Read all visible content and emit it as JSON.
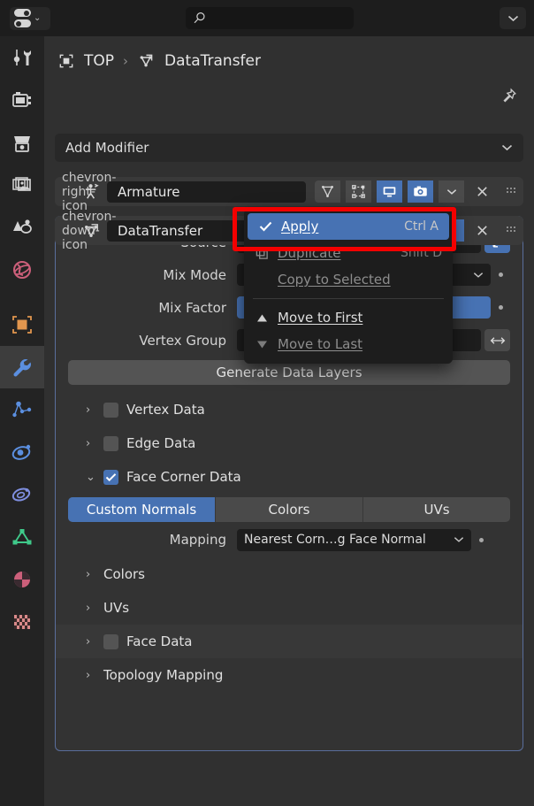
{
  "topbar": {
    "editor_type_icon": "editor-type-toggles-icon",
    "editor_type_chevron": "⌄",
    "search_icon": "search-icon",
    "search_value": "",
    "search_placeholder": "",
    "right_chevron": "⌄"
  },
  "sidebar": {
    "items": [
      {
        "name": "tool",
        "icon": "tool-screwdriver-wrench-icon",
        "color": "#d3d3d3",
        "active": false
      },
      {
        "name": "render",
        "icon": "render-camera-back-icon",
        "color": "#d3d3d3",
        "active": false
      },
      {
        "name": "output",
        "icon": "output-printer-icon",
        "color": "#d3d3d3",
        "active": false
      },
      {
        "name": "view-layer",
        "icon": "view-layer-images-icon",
        "color": "#d3d3d3",
        "active": false
      },
      {
        "name": "scene",
        "icon": "scene-cone-sphere-icon",
        "color": "#d3d3d3",
        "active": false
      },
      {
        "name": "world",
        "icon": "world-globe-icon",
        "color": "#cc5f7a",
        "active": false
      },
      {
        "name": "object",
        "icon": "object-square-brackets-icon",
        "color": "#e2964e",
        "active": false
      },
      {
        "name": "modifiers",
        "icon": "wrench-icon",
        "color": "#5b8fe0",
        "active": true
      },
      {
        "name": "particles",
        "icon": "particles-icon",
        "color": "#5b8fe0",
        "active": false
      },
      {
        "name": "physics",
        "icon": "physics-orbit-icon",
        "color": "#5b8fe0",
        "active": false
      },
      {
        "name": "constraints",
        "icon": "constraints-clamp-icon",
        "color": "#7f8fe0",
        "active": false
      },
      {
        "name": "object-data",
        "icon": "object-data-triangle-icon",
        "color": "#3fc98a",
        "active": false
      },
      {
        "name": "material",
        "icon": "material-sphere-icon",
        "color": "#cc5f7a",
        "active": false
      },
      {
        "name": "texture",
        "icon": "texture-checker-icon",
        "color": "#d98a8a",
        "active": false
      }
    ]
  },
  "breadcrumb": {
    "object_icon": "object-brackets-icon",
    "object_label": "TOP",
    "separator": "›",
    "modifier_icon": "datatransfer-modifier-icon",
    "modifier_label": "DataTransfer",
    "pin_icon": "pin-icon"
  },
  "add_modifier": {
    "label": "Add Modifier",
    "chevron": "⌄"
  },
  "modifiers": [
    {
      "expand_icon": "chevron-right-icon",
      "expanded": false,
      "type_icon": "armature-modifier-icon",
      "name": "Armature",
      "toggles": [
        {
          "name": "edit-mode-toggle",
          "icon": "triangle-mesh-icon",
          "on": false
        },
        {
          "name": "on-cage-toggle",
          "icon": "cage-vertices-icon",
          "on": false
        },
        {
          "name": "realtime-toggle",
          "icon": "display-monitor-icon",
          "on": true
        },
        {
          "name": "render-toggle",
          "icon": "camera-icon",
          "on": true
        }
      ],
      "dropdown_icon": "chevron-down-icon",
      "close_icon": "close-x-icon",
      "drag_icon": "drag-handle-dots-icon"
    },
    {
      "expand_icon": "chevron-down-icon",
      "expanded": true,
      "type_icon": "datatransfer-modifier-icon",
      "name": "DataTransfer",
      "toggles": [
        {
          "name": "edit-mode-toggle",
          "icon": "triangle-mesh-icon",
          "on": false
        },
        {
          "name": "on-cage-toggle",
          "icon": "cage-vertices-icon",
          "on": false
        },
        {
          "name": "realtime-toggle",
          "icon": "display-monitor-icon",
          "on": true
        },
        {
          "name": "render-toggle",
          "icon": "camera-icon",
          "on": true
        }
      ],
      "dropdown_icon": "chevron-down-icon",
      "close_icon": "close-x-icon",
      "drag_icon": "drag-handle-dots-icon"
    }
  ],
  "properties": {
    "source": {
      "label": "Source",
      "value": "",
      "object_transform_icon": "object-transform-icon",
      "object_transform_on": true
    },
    "mix_mode": {
      "label": "Mix Mode",
      "value": "",
      "chevron": "⌄",
      "animate_dot": "animate-dot"
    },
    "mix_factor": {
      "label": "Mix Factor",
      "value": "",
      "animate_dot": "animate-dot"
    },
    "vertex_group": {
      "label": "Vertex Group",
      "value": "",
      "invert_icon": "invert-arrows-icon"
    },
    "generate_button": {
      "label": "Generate Data Layers"
    },
    "sections": [
      {
        "name": "vertex-data",
        "label": "Vertex Data",
        "arrow": "›",
        "checkbox": true,
        "checked": false,
        "expanded": false
      },
      {
        "name": "edge-data",
        "label": "Edge Data",
        "arrow": "›",
        "checkbox": true,
        "checked": false,
        "expanded": false
      },
      {
        "name": "face-corner-data",
        "label": "Face Corner Data",
        "arrow": "⌄",
        "checkbox": true,
        "checked": true,
        "expanded": true
      }
    ],
    "face_corner_tabs": [
      {
        "name": "custom-normals",
        "label": "Custom Normals",
        "active": true
      },
      {
        "name": "colors",
        "label": "Colors",
        "active": false
      },
      {
        "name": "uvs",
        "label": "UVs",
        "active": false
      }
    ],
    "mapping": {
      "label": "Mapping",
      "value": "Nearest Corn…g Face Normal",
      "chevron": "⌄",
      "animate_dot": "animate-dot"
    },
    "bottom_sections": [
      {
        "name": "colors",
        "label": "Colors",
        "arrow": "›",
        "checkbox": false,
        "checked": false
      },
      {
        "name": "uvs",
        "label": "UVs",
        "arrow": "›",
        "checkbox": false,
        "checked": false
      },
      {
        "name": "face-data",
        "label": "Face Data",
        "arrow": "›",
        "checkbox": true,
        "checked": false
      },
      {
        "name": "topology-mapping",
        "label": "Topology Mapping",
        "arrow": "›",
        "checkbox": false,
        "checked": false
      }
    ]
  },
  "context_menu": {
    "items": [
      {
        "name": "apply",
        "label": "Apply",
        "shortcut": "Ctrl A",
        "icon": "check-icon",
        "highlighted": true,
        "disabled": false,
        "underline_index": 0
      },
      {
        "name": "duplicate",
        "label": "Duplicate",
        "shortcut": "Shift D",
        "icon": "duplicate-icon",
        "highlighted": false,
        "disabled": true,
        "underline_index": 0
      },
      {
        "name": "copy-to-selected",
        "label": "Copy to Selected",
        "shortcut": "",
        "icon": "",
        "highlighted": false,
        "disabled": true,
        "underline_index": 0
      },
      {
        "name": "move-to-first",
        "label": "Move to First",
        "shortcut": "",
        "icon": "triangle-up-icon",
        "highlighted": false,
        "disabled": false,
        "underline_index": 0
      },
      {
        "name": "move-to-last",
        "label": "Move to Last",
        "shortcut": "",
        "icon": "triangle-down-icon",
        "highlighted": false,
        "disabled": true,
        "underline_index": 5
      }
    ],
    "separator_after_index": 2
  },
  "highlight": {
    "name": "red-annotation-box",
    "color": "#f40000"
  },
  "colors": {
    "accent_blue": "#4772b3",
    "panel_bg": "#333333",
    "app_bg": "#303030",
    "rail_bg": "#232323",
    "topbar_bg": "#1d1d1d"
  }
}
